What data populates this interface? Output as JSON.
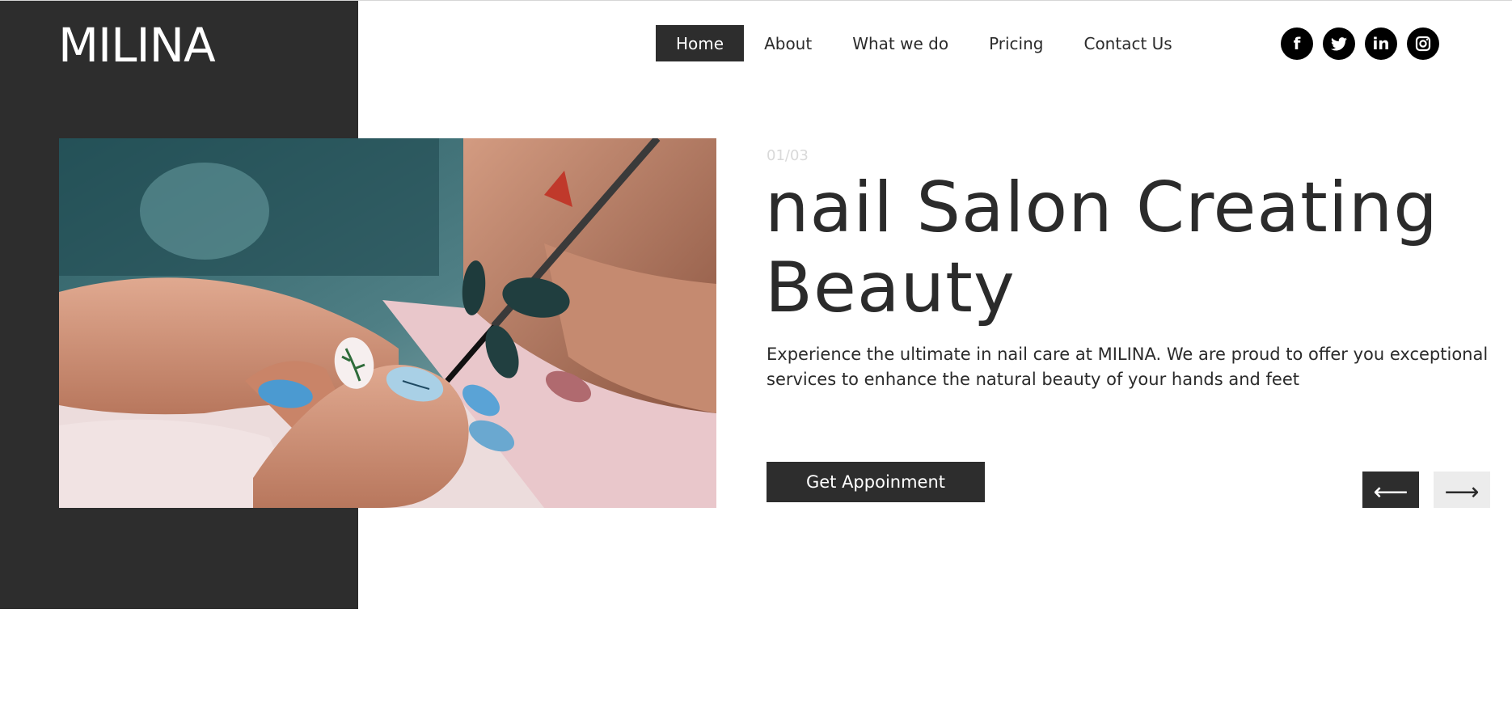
{
  "brand": {
    "logo": "MILINA"
  },
  "nav": {
    "items": [
      {
        "label": "Home",
        "active": true
      },
      {
        "label": "About"
      },
      {
        "label": "What we do"
      },
      {
        "label": "Pricing"
      },
      {
        "label": "Contact Us"
      }
    ]
  },
  "social": [
    {
      "icon": "facebook-icon",
      "glyph": "f"
    },
    {
      "icon": "twitter-icon",
      "glyph": "🐦"
    },
    {
      "icon": "linkedin-icon",
      "glyph": "in"
    },
    {
      "icon": "instagram-icon",
      "glyph": "◎"
    }
  ],
  "hero": {
    "counter": "01/03",
    "title": "nail Salon Creating Beauty",
    "description": "Experience the ultimate in nail care at MILINA. We are proud to offer you exceptional services to enhance the natural beauty of your hands and feet",
    "cta_label": "Get Appoinment",
    "prev_arrow": "⟵",
    "next_arrow": "⟶"
  },
  "colors": {
    "dark": "#2d2d2d",
    "text": "#2b2b2b",
    "counter": "#d9d9d9",
    "next_button_bg": "#ececec"
  }
}
